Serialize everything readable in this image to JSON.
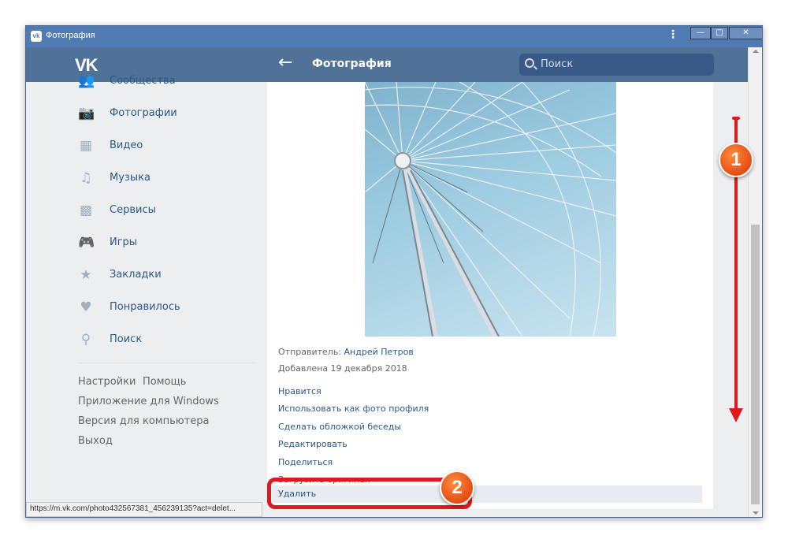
{
  "window": {
    "title": "Фотография",
    "kebab": "⋮",
    "min": "—",
    "max": "□",
    "close": "✕"
  },
  "header": {
    "logo": "VK",
    "back": "←",
    "title": "Фотография",
    "search_placeholder": "Поиск"
  },
  "sidebar": {
    "items": [
      {
        "label": "Сообщества",
        "icon": "👥"
      },
      {
        "label": "Фотографии",
        "icon": "📷"
      },
      {
        "label": "Видео",
        "icon": "▦"
      },
      {
        "label": "Музыка",
        "icon": "♫"
      },
      {
        "label": "Сервисы",
        "icon": "▩"
      },
      {
        "label": "Игры",
        "icon": "🎮"
      },
      {
        "label": "Закладки",
        "icon": "★"
      },
      {
        "label": "Понравилось",
        "icon": "♥"
      },
      {
        "label": "Поиск",
        "icon": "⚲"
      }
    ],
    "footer": {
      "settings": "Настройки",
      "help": "Помощь",
      "windows_app": "Приложение для Windows",
      "desktop": "Версия для компьютера",
      "logout": "Выход"
    }
  },
  "photo": {
    "sender_label": "Отправитель:",
    "sender_name": "Андрей Петров",
    "added": "Добавлена 19 декабря 2018",
    "actions": [
      "Нравится",
      "Использовать как фото профиля",
      "Сделать обложкой беседы",
      "Редактировать",
      "Поделиться",
      "Загрузить оригинал"
    ],
    "delete": "Удалить"
  },
  "status_url": "https://m.vk.com/photo432567381_456239135?act=delet...",
  "badges": {
    "one": "1",
    "two": "2"
  },
  "colors": {
    "header": "#507299",
    "titlebar": "#4f7bb2",
    "link": "#2a5885",
    "annotation": "#e0191f"
  }
}
